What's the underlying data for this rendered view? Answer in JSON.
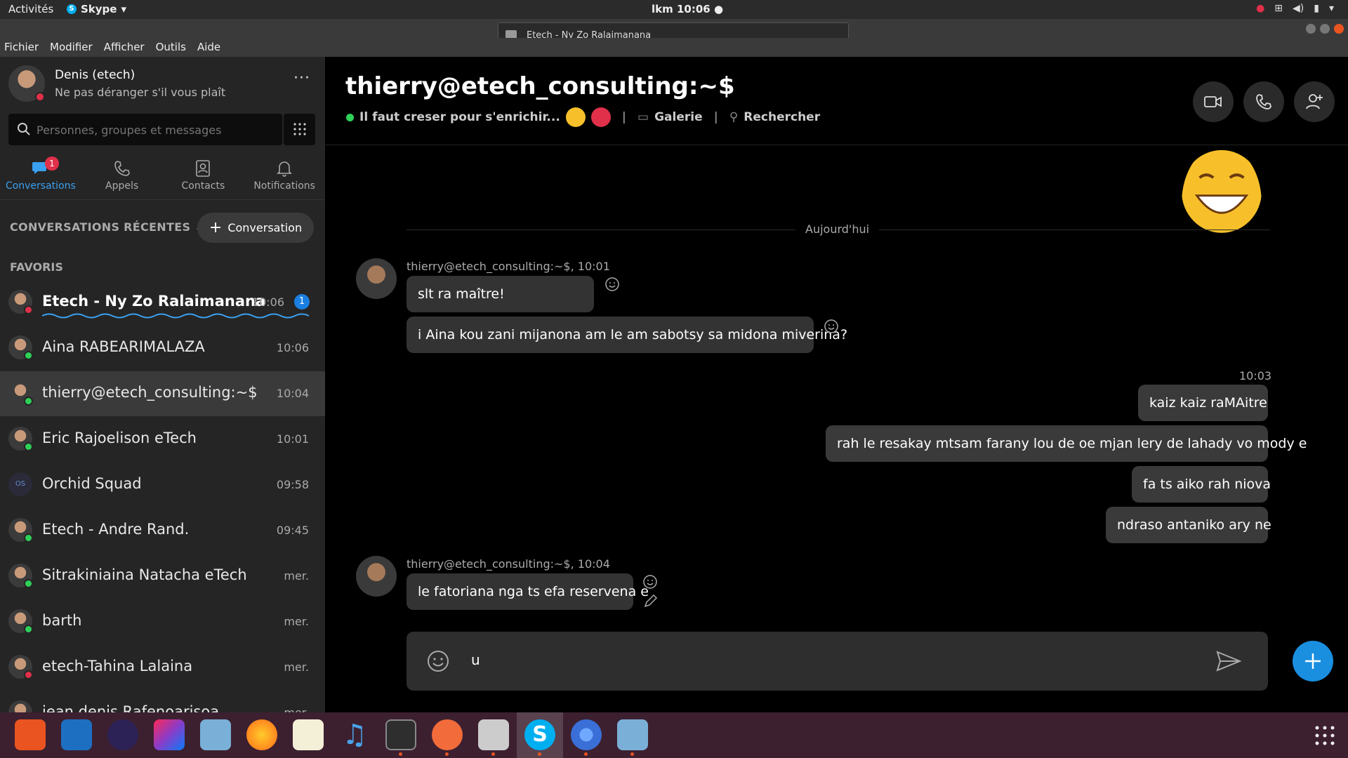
{
  "topbar": {
    "activities": "Activités",
    "app_name": "Skype",
    "clock": "lkm 10:06 ●"
  },
  "notification": {
    "title": "Etech - Ny Zo Ralaimanana",
    "body": ":D"
  },
  "menubar": [
    "Fichier",
    "Modifier",
    "Afficher",
    "Outils",
    "Aide"
  ],
  "profile": {
    "name": "Denis (etech)",
    "status": "Ne pas déranger s'il vous plaît",
    "more": "···"
  },
  "search": {
    "placeholder": "Personnes, groupes et messages"
  },
  "navtabs": [
    {
      "label": "Conversations",
      "badge": "1"
    },
    {
      "label": "Appels"
    },
    {
      "label": "Contacts"
    },
    {
      "label": "Notifications"
    }
  ],
  "recent_header": "CONVERSATIONS RÉCENTES",
  "new_conversation": "Conversation",
  "favorites_header": "FAVORIS",
  "conversations": [
    {
      "name": "Etech - Ny Zo Ralaimanana",
      "time": "10:06",
      "badge": "1",
      "status": "dnd"
    },
    {
      "name": "Aina RABEARIMALAZA",
      "time": "10:06",
      "status": "online"
    },
    {
      "name": "thierry@etech_consulting:~$",
      "time": "10:04",
      "status": "online"
    },
    {
      "name": "Eric Rajoelison eTech",
      "time": "10:01",
      "status": "online"
    },
    {
      "name": "Orchid Squad",
      "time": "09:58",
      "initials": "OS"
    },
    {
      "name": "Etech - Andre Rand.",
      "time": "09:45",
      "status": "online"
    },
    {
      "name": "Sitrakiniaina Natacha eTech",
      "time": "mer.",
      "status": "online"
    },
    {
      "name": "barth",
      "time": "mer.",
      "status": "online"
    },
    {
      "name": "etech-Tahina Lalaina",
      "time": "mer.",
      "status": "dnd"
    },
    {
      "name": "jean denis Rafenoarisoa",
      "time": "mer."
    }
  ],
  "chat": {
    "title": "thierry@etech_consulting:~$",
    "mood": "Il faut creser pour s'enrichir...",
    "sep1": "|",
    "gallery": "Galerie",
    "sep2": "|",
    "search": "Rechercher",
    "day_label": "Aujourd'hui",
    "incoming1_sender": "thierry@etech_consulting:~$, 10:01",
    "incoming1": [
      "slt ra maître!",
      "i Aina kou zani mijanona am le am sabotsy sa midona miverina?"
    ],
    "outgoing_time": "10:03",
    "outgoing": [
      "kaiz kaiz raMAitre",
      "rah le resakay mtsam farany lou de oe mjan lery de lahady vo mody e",
      "fa ts aiko rah niova",
      "ndraso antaniko ary ne"
    ],
    "incoming2_sender": "thierry@etech_consulting:~$, 10:04",
    "incoming2": [
      "le fatoriana nga ts efa reservena e"
    ],
    "composer_text": "u"
  },
  "colors": {
    "accent": "#1a8fe0",
    "dnd": "#e0304a",
    "online": "#2ed158",
    "sidebar_bg": "#252525"
  }
}
